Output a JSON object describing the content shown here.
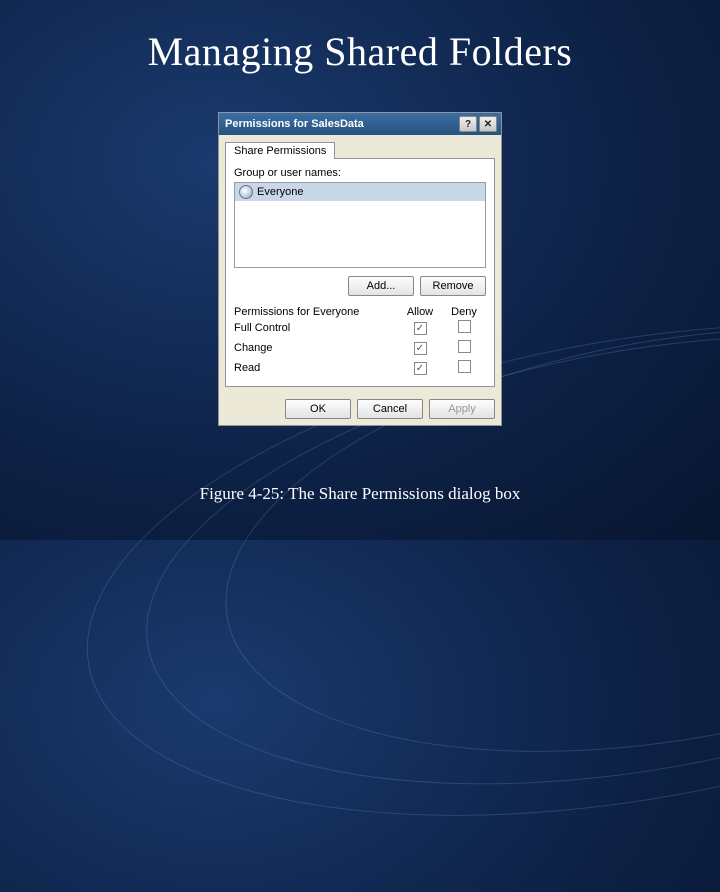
{
  "slide": {
    "title": "Managing Shared Folders",
    "caption": "Figure 4-25: The Share Permissions dialog box"
  },
  "dialog": {
    "title": "Permissions for SalesData",
    "help_glyph": "?",
    "close_glyph": "✕",
    "tab_label": "Share Permissions",
    "group_label": "Group or user names:",
    "principals": [
      {
        "name": "Everyone"
      }
    ],
    "add_label": "Add...",
    "remove_label": "Remove",
    "perm_header_name": "Permissions for Everyone",
    "perm_header_allow": "Allow",
    "perm_header_deny": "Deny",
    "permissions": [
      {
        "name": "Full Control",
        "allow": true,
        "deny": false
      },
      {
        "name": "Change",
        "allow": true,
        "deny": false
      },
      {
        "name": "Read",
        "allow": true,
        "deny": false
      }
    ],
    "ok_label": "OK",
    "cancel_label": "Cancel",
    "apply_label": "Apply"
  }
}
